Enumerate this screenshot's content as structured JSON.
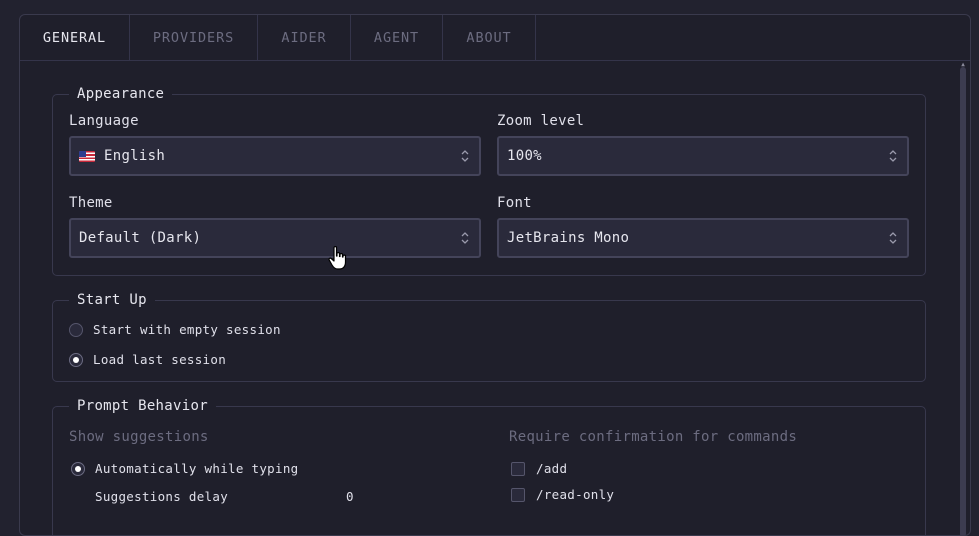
{
  "tabs": [
    {
      "label": "GENERAL",
      "active": true
    },
    {
      "label": "PROVIDERS",
      "active": false
    },
    {
      "label": "AIDER",
      "active": false
    },
    {
      "label": "AGENT",
      "active": false
    },
    {
      "label": "ABOUT",
      "active": false
    }
  ],
  "appearance": {
    "legend": "Appearance",
    "language": {
      "label": "Language",
      "value": "English",
      "flag": "us-flag-icon"
    },
    "zoom": {
      "label": "Zoom level",
      "value": "100%"
    },
    "theme": {
      "label": "Theme",
      "value": "Default (Dark)"
    },
    "font": {
      "label": "Font",
      "value": "JetBrains Mono"
    }
  },
  "startup": {
    "legend": "Start Up",
    "options": [
      {
        "label": "Start with empty session",
        "selected": false
      },
      {
        "label": "Load last session",
        "selected": true
      }
    ]
  },
  "prompt": {
    "legend": "Prompt Behavior",
    "suggestions_heading": "Show suggestions",
    "suggestions_option": "Automatically while typing",
    "delay_label": "Suggestions delay",
    "delay_value": "0",
    "confirm_heading": "Require confirmation for commands",
    "commands": [
      "/add",
      "/read-only"
    ]
  },
  "colors": {
    "background": "#22222f",
    "panel": "#1f1f2b",
    "input": "#2a2a3b",
    "muted_text": "#6c6c80"
  }
}
